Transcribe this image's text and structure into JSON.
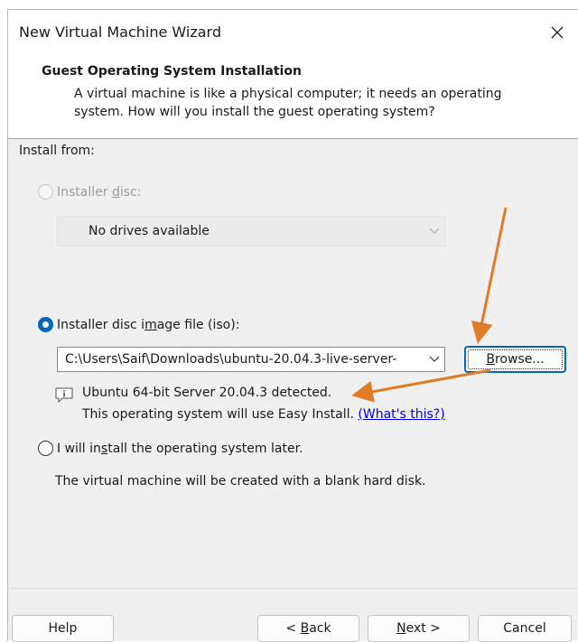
{
  "window": {
    "title": "New Virtual Machine Wizard"
  },
  "header": {
    "title": "Guest Operating System Installation",
    "description_line1": "A virtual machine is like a physical computer; it needs an operating",
    "description_line2": "system. How will you install the guest operating system?"
  },
  "install_from": {
    "label": "Install from:",
    "disc_option": {
      "label_pre": "Installer ",
      "label_mnemonic": "d",
      "label_post": "isc:",
      "selected": false,
      "enabled": false
    },
    "disc_combo": {
      "value": "No drives available"
    },
    "iso_option": {
      "label_pre": "Installer disc i",
      "label_mnemonic": "m",
      "label_post": "age file (iso):",
      "selected": true
    },
    "iso_combo": {
      "value": "C:\\Users\\Saif\\Downloads\\ubuntu-20.04.3-live-server-"
    },
    "browse_button": {
      "label_mnemonic": "B",
      "label_post": "rowse..."
    },
    "detected": {
      "text": "Ubuntu 64-bit Server 20.04.3 detected.",
      "easy_install_text": "This operating system will use Easy Install. ",
      "link_text": "(What's this?)"
    },
    "later_option": {
      "label_pre": "I will in",
      "label_mnemonic": "s",
      "label_post": "tall the operating system later.",
      "selected": false
    },
    "later_description": "The virtual machine will be created with a blank hard disk."
  },
  "footer": {
    "help_label": "Help",
    "back_pre": "< ",
    "back_mnemonic": "B",
    "back_post": "ack",
    "next_mnemonic": "N",
    "next_post": "ext >",
    "cancel_label": "Cancel"
  },
  "colors": {
    "accent": "#0067c0",
    "annotation_arrow": "#e07b28",
    "link": "#0000ee"
  },
  "icons": {
    "close": "close-icon",
    "chevron": "chevron-down-icon",
    "info": "info-icon"
  }
}
